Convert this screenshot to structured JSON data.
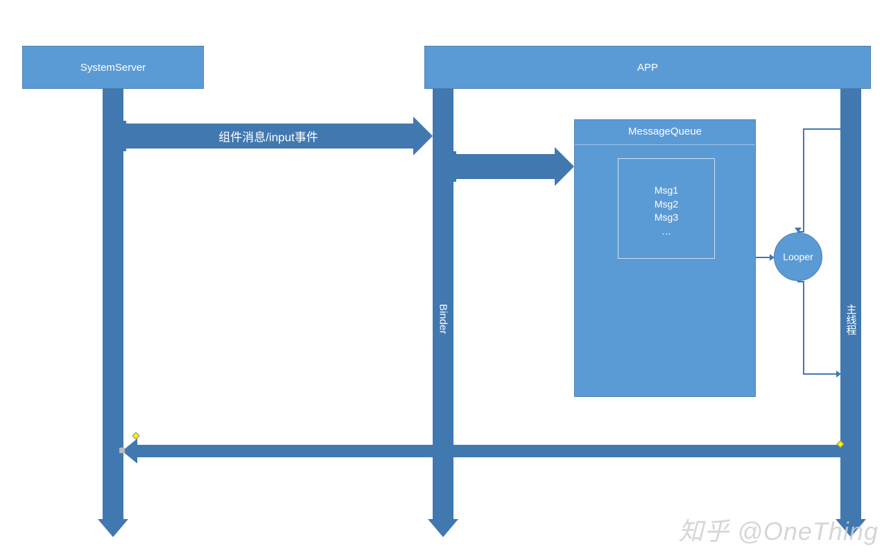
{
  "headers": {
    "system_server": "SystemServer",
    "app": "APP"
  },
  "lifelines": {
    "binder_label": "Binder",
    "main_thread_label": "主线程"
  },
  "arrows": {
    "input_event_label": "组件消息/input事件"
  },
  "message_queue": {
    "title": "MessageQueue",
    "msgs": [
      "Msg1",
      "Msg2",
      "Msg3",
      "…"
    ]
  },
  "looper": {
    "label": "Looper"
  },
  "watermark": "知乎 @OneThing",
  "colors": {
    "fill": "#5b9bd5",
    "dark": "#4178b0"
  }
}
